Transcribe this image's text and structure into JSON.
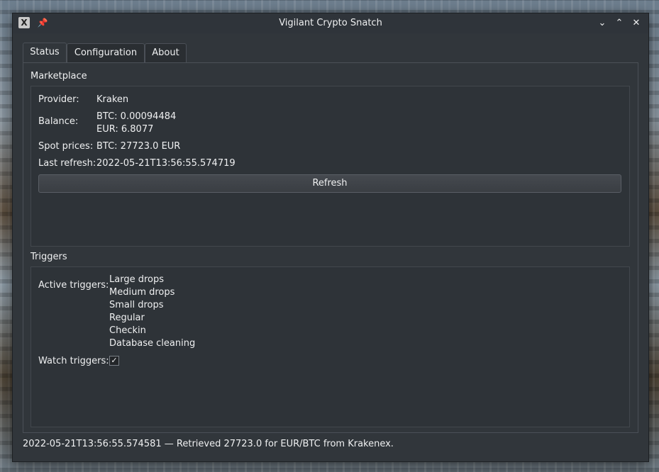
{
  "window": {
    "title": "Vigilant Crypto Snatch",
    "icons": {
      "app": "x-app-icon",
      "pin": "pin-icon",
      "minimize": "chevron-down-icon",
      "maximize": "chevron-up-icon",
      "close": "close-icon"
    },
    "app_icon_glyph": "X",
    "pin_glyph": "📌",
    "minimize_glyph": "⌄",
    "maximize_glyph": "⌃",
    "close_glyph": "✕"
  },
  "tabs": [
    {
      "label": "Status",
      "active": true
    },
    {
      "label": "Configuration",
      "active": false
    },
    {
      "label": "About",
      "active": false
    }
  ],
  "marketplace": {
    "title": "Marketplace",
    "provider_label": "Provider:",
    "provider_value": "Kraken",
    "balance_label": "Balance:",
    "balance_lines": [
      "BTC: 0.00094484",
      "EUR: 6.8077"
    ],
    "spot_label": "Spot prices:",
    "spot_value": "BTC: 27723.0 EUR",
    "refresh_label": "Last refresh:",
    "refresh_value": "2022-05-21T13:56:55.574719",
    "refresh_button": "Refresh"
  },
  "triggers": {
    "title": "Triggers",
    "active_label": "Active triggers:",
    "active_list": [
      "Large drops",
      "Medium drops",
      "Small drops",
      "Regular",
      "Checkin",
      "Database cleaning"
    ],
    "watch_label": "Watch triggers:",
    "watch_checked": true,
    "check_glyph": "✓"
  },
  "status_bar": "2022-05-21T13:56:55.574581 — Retrieved 27723.0 for EUR/BTC from Krakenex."
}
